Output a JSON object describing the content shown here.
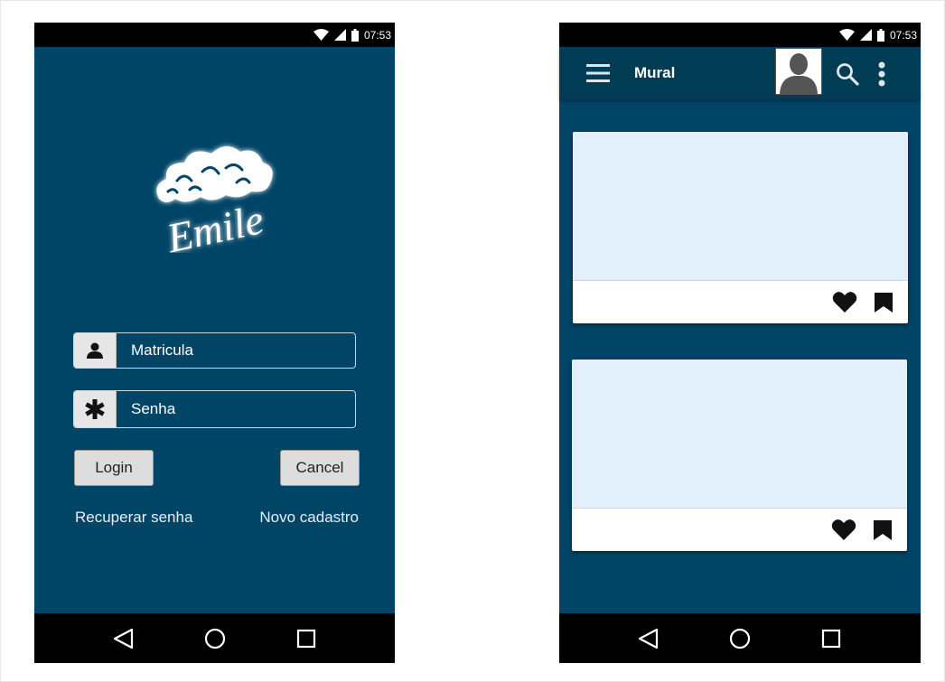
{
  "login_screen": {
    "status_time": "07:53",
    "logo_text": "Emile",
    "username_placeholder": "Matricula",
    "password_placeholder": "Senha",
    "login_label": "Login",
    "cancel_label": "Cancel",
    "recover_link": "Recuperar senha",
    "signup_link": "Novo cadastro"
  },
  "mural_screen": {
    "status_time": "07:53",
    "title": "Mural",
    "cards": [
      {
        "actions": [
          "heart-icon",
          "bookmark-icon"
        ]
      },
      {
        "actions": [
          "heart-icon",
          "bookmark-icon"
        ]
      }
    ]
  },
  "colors": {
    "background": "#004466",
    "appbar": "#003d55",
    "card_media": "#e1f0fb",
    "system_bar": "#000000"
  }
}
